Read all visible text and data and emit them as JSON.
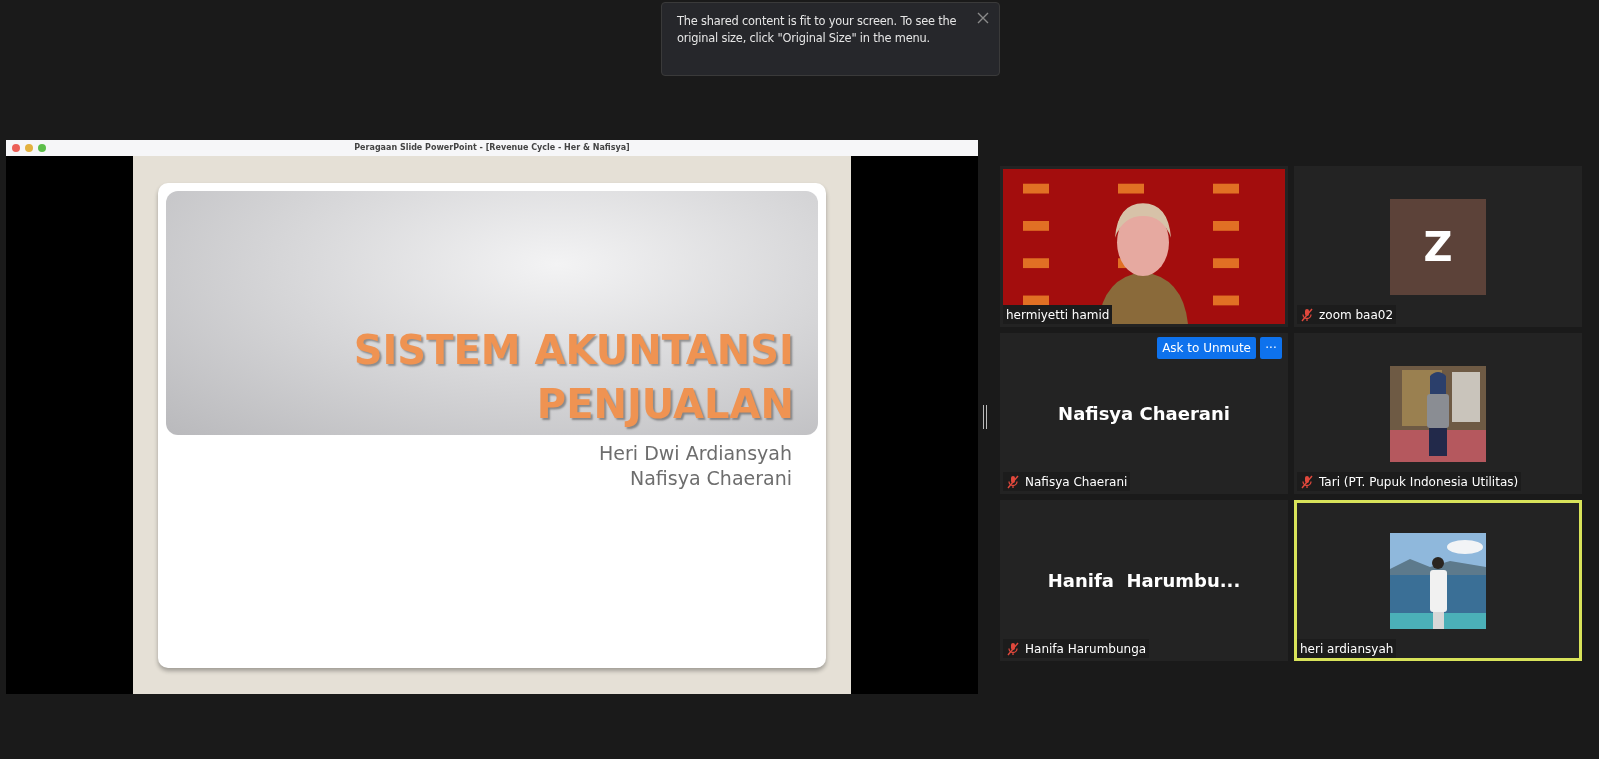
{
  "notice": {
    "text": "The shared content is fit to your screen. To see the original size, click \"Original Size\" in the menu."
  },
  "shared_window": {
    "title": "Peragaan Slide PowerPoint - [Revenue Cycle - Her & Nafisya]",
    "slide": {
      "title_lines": [
        "SISTEM AKUNTANSI",
        "PENJUALAN"
      ],
      "subtitle_lines": [
        "Heri Dwi Ardiansyah",
        "Nafisya Chaerani"
      ]
    }
  },
  "tiles": [
    {
      "kind": "video",
      "label": "hermiyetti hamid",
      "muted": false,
      "speaking": false
    },
    {
      "kind": "avatar",
      "initial": "Z",
      "label": "zoom baa02",
      "muted": true,
      "speaking": false
    },
    {
      "kind": "name",
      "display_name": "Nafisya Chaerani",
      "label": "Nafisya Chaerani",
      "muted": true,
      "speaking": false,
      "hover_button": "Ask to Unmute",
      "more_button": "···"
    },
    {
      "label": "Tari (PT. Pupuk Indonesia Utilitas)",
      "muted": true,
      "speaking": false
    },
    {
      "kind": "name",
      "display_name": "Hanifa  Harumbu...",
      "label": "Hanifa Harumbunga",
      "muted": true,
      "speaking": false
    },
    {
      "label": "heri ardiansyah",
      "muted": false,
      "speaking": true
    }
  ]
}
